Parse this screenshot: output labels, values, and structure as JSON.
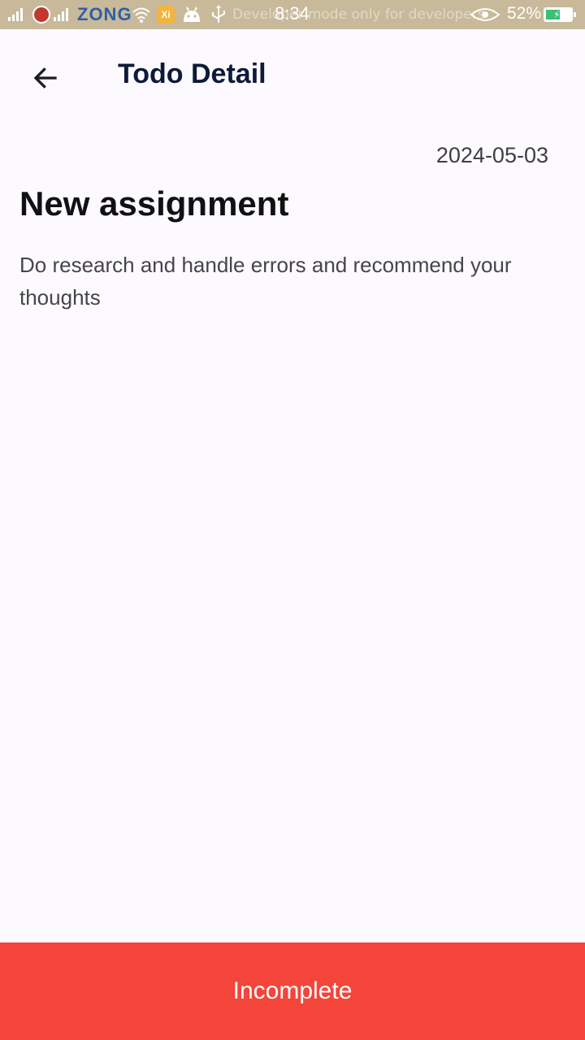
{
  "status_bar": {
    "carrier": "ZONG",
    "app_badge": "Xi",
    "developer_text": "Developer mode only for developers",
    "time": "8:34",
    "battery_percent": "52%",
    "battery_level": 0.52,
    "colors": {
      "background": "#c8b99a",
      "carrier": "#2f5fa8",
      "battery_fill": "#38c172"
    }
  },
  "app_bar": {
    "title": "Todo Detail",
    "back_icon": "arrow-left-icon"
  },
  "todo": {
    "date": "2024-05-03",
    "title": "New assignment",
    "description": "Do research and handle errors and recommend your thoughts"
  },
  "action": {
    "status_label": "Incomplete",
    "color": "#f4453a"
  }
}
